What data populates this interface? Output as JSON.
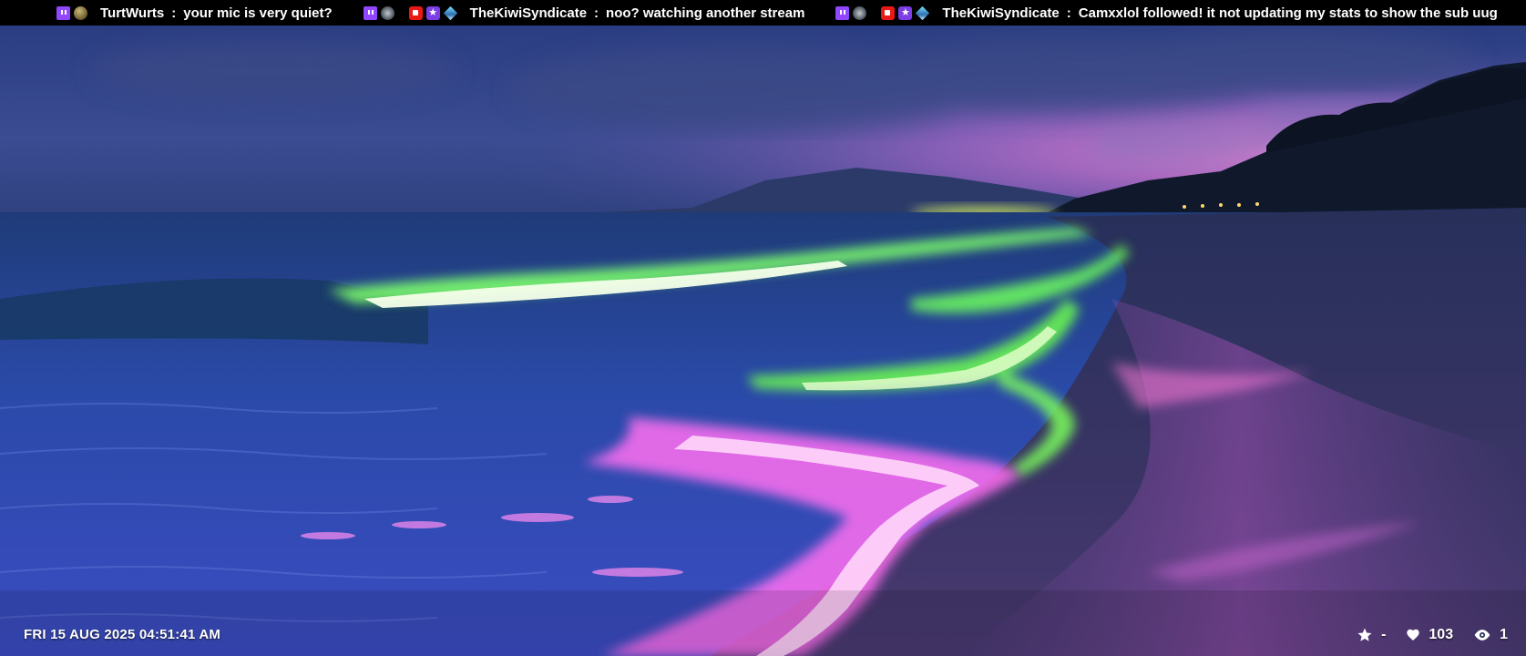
{
  "chat": {
    "messages": [
      {
        "user": "TurtWurts",
        "separator": ":",
        "text": "your mic is very quiet?",
        "badges": [
          "twitch-badge-icon",
          "coin-badge-icon"
        ]
      },
      {
        "user": "TheKiwiSyndicate",
        "separator": ":",
        "text": "noo?  watching another stream",
        "badges": [
          "twitch-badge-icon",
          "snail-badge-icon",
          "camera-badge-icon",
          "star-badge-icon",
          "gem-badge-icon"
        ]
      },
      {
        "user": "TheKiwiSyndicate",
        "separator": ":",
        "text": "Camxxlol followed!  it not updating my stats to show the sub uug",
        "badges": [
          "twitch-badge-icon",
          "snail-badge-icon",
          "camera-badge-icon",
          "star-badge-icon",
          "gem-badge-icon"
        ]
      }
    ]
  },
  "overlay": {
    "datetime": "FRI 15 AUG 2025 04:51:41 AM",
    "stats": {
      "rating_icon": "star-icon",
      "rating_value": "-",
      "likes_icon": "heart-icon",
      "likes_value": "103",
      "viewers_icon": "eye-icon",
      "viewers_value": "1"
    }
  },
  "colors": {
    "ticker_bg": "#000000",
    "twitch_purple": "#9146ff",
    "glow_green": "#5dff6a",
    "glow_pink": "#ff5ef0"
  }
}
